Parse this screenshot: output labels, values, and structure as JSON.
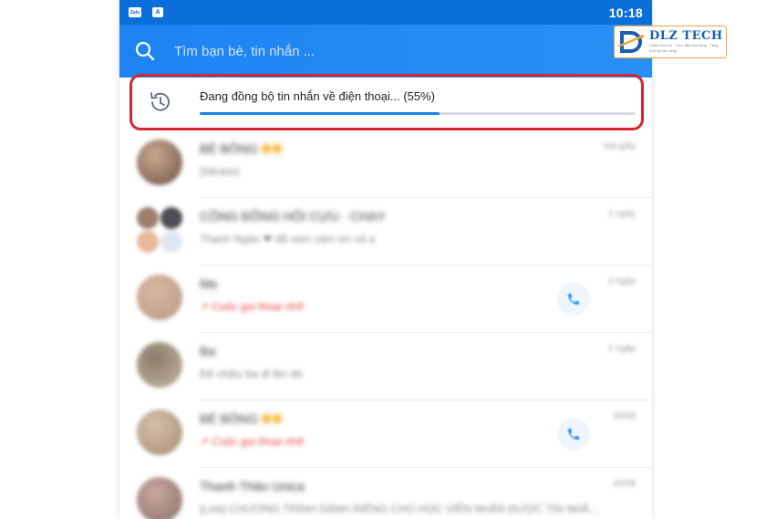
{
  "status_bar": {
    "icon_1": "Zalo",
    "icon_2": "A",
    "time": "10:18"
  },
  "search": {
    "placeholder": "Tìm bạn bè, tin nhắn ..."
  },
  "watermark": {
    "brand": "DLZ TECH",
    "tagline": "Chiến lược số · Thúc đẩy bán hàng · Tăng trưởng bền vững"
  },
  "sync": {
    "text": "Đang đồng bộ tin nhắn về điện thoại... (55%)",
    "progress_percent": 55
  },
  "colors": {
    "header_blue": "#1d83f2",
    "status_blue": "#0a6fd8",
    "progress_blue": "#1a83e8",
    "highlight_red": "#d6262f",
    "missed_call_red": "#e8433f"
  },
  "chats": [
    {
      "name": "BÉ BÔNG",
      "preview": "[Sticker]",
      "time": "Vài giây",
      "missed": false,
      "has_call_button": false,
      "has_badge": true
    },
    {
      "name": "CỘNG ĐỒNG HỘI CỰU · CHẠY",
      "preview": "Thanh Ngân ❤ đã xem cảm ơn cả a",
      "time": "1 ngày",
      "missed": false,
      "has_call_button": false,
      "has_badge": false,
      "group": true
    },
    {
      "name": "Mẹ",
      "preview": "↗ Cuộc gọi thoại nhỡ",
      "time": "2 ngày",
      "missed": true,
      "has_call_button": true,
      "has_badge": false
    },
    {
      "name": "Ba",
      "preview": "Để chiều ba đi lên đó",
      "time": "2 ngày",
      "missed": false,
      "has_call_button": false,
      "has_badge": false
    },
    {
      "name": "BÉ BÔNG",
      "preview": "↗ Cuộc gọi thoại nhỡ",
      "time": "29/08",
      "missed": true,
      "has_call_button": true,
      "has_badge": true
    },
    {
      "name": "Thanh Thảo Unica",
      "preview": "[Link] CHƯƠNG TRÌNH DÀNH RIÊNG CHO HỌC VIÊN NHẬN ĐƯỢC TIN NHẮ...",
      "time": "26/08",
      "missed": false,
      "has_call_button": false,
      "has_badge": false
    }
  ]
}
